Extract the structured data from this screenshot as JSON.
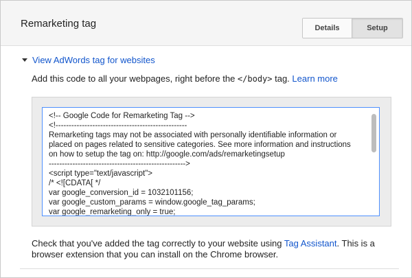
{
  "header": {
    "title": "Remarketing tag",
    "tabs": [
      {
        "label": "Details",
        "selected": false
      },
      {
        "label": "Setup",
        "selected": true
      }
    ]
  },
  "section": {
    "toggle_label": "View AdWords tag for websites",
    "expanded": true
  },
  "instruction": {
    "prefix": "Add this code to all your webpages, right before the ",
    "code_tag": "</body>",
    "suffix": " tag. ",
    "learn_more": "Learn more"
  },
  "code_lines": [
    "<!-- Google Code for Remarketing Tag -->",
    "<!--------------------------------------------------",
    "Remarketing tags may not be associated with personally identifiable information or",
    "placed on pages related to sensitive categories. See more information and instructions",
    "on how to setup the tag on: http://google.com/ads/remarketingsetup",
    "---------------------------------------------------->",
    "<script type=\"text/javascript\">",
    "/* <![CDATA[ */",
    "var google_conversion_id = 1032101156;",
    "var google_custom_params = window.google_tag_params;",
    "var google_remarketing_only = true;"
  ],
  "footer": {
    "prefix": "Check that you've added the tag correctly to your website using ",
    "link": "Tag Assistant",
    "suffix": ". This is a browser extension that you can install on the Chrome browser."
  },
  "colors": {
    "link": "#1155cc",
    "focus_border": "#4d90fe",
    "header_bg": "#f5f5f5",
    "selected_tab_bg": "#e2e2e2"
  }
}
